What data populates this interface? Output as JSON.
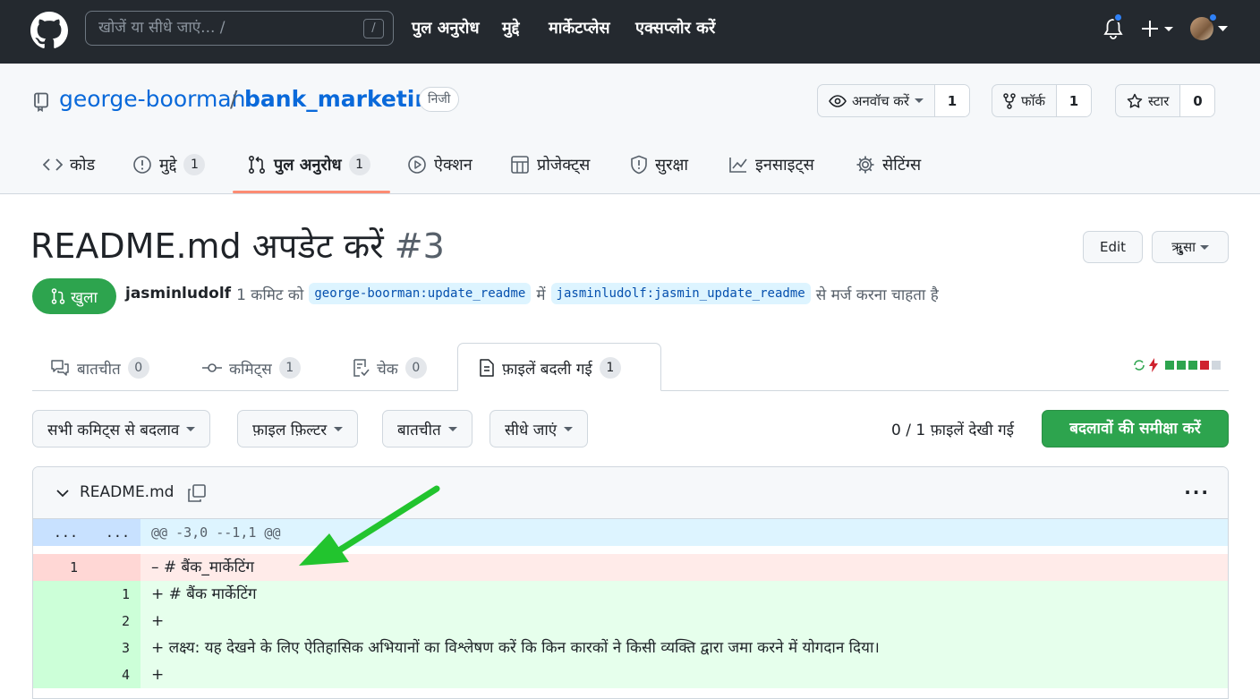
{
  "topnav": {
    "search_placeholder": "खोजें या सीधे जाएं... /",
    "search_key": "/",
    "links": [
      "पुल अनुरोध",
      "मुद्दे",
      "मार्केटप्लेस",
      "एक्सप्लोर करें"
    ],
    "icons": [
      "github-logo-icon",
      "bell-icon",
      "plus-icon",
      "avatar"
    ],
    "accent": "#2f81f7"
  },
  "repo": {
    "owner": "george-boorman",
    "separator": "/",
    "name": "bank_marketing",
    "visibility": "निजी",
    "watch": {
      "label": "अनवॉच करें",
      "count": "1"
    },
    "fork": {
      "label": "फॉर्क",
      "count": "1"
    },
    "star": {
      "label": "स्टार",
      "count": "0"
    },
    "tabs": [
      {
        "label": "कोड"
      },
      {
        "label": "मुद्दे",
        "count": "1"
      },
      {
        "label": "पुल अनुरोध",
        "count": "1"
      },
      {
        "label": "ऐक्शन"
      },
      {
        "label": "प्रोजेक्ट्स"
      },
      {
        "label": "सुरक्षा"
      },
      {
        "label": "इनसाइट्स"
      },
      {
        "label": "सेटिंग्स"
      }
    ]
  },
  "pr": {
    "title": "README.md अपडेट करें",
    "number": "#3",
    "edit_label": "Edit",
    "code_label": "ॠुसा",
    "state": "खुला",
    "author": "jasminludolf",
    "commits_text": "1 कमिट को",
    "base_branch": "george-boorman:update_readme",
    "in_text": "में",
    "head_branch": "jasminludolf:jasmin_update_readme",
    "suffix": "से मर्ज करना चाहता है",
    "state_color": "#2da44e"
  },
  "pr_tabs": [
    {
      "label": "बातचीत",
      "count": "0"
    },
    {
      "label": "कमिट्स",
      "count": "1"
    },
    {
      "label": "चेक",
      "count": "0"
    },
    {
      "label": "फ़ाइलें बदली गई",
      "count": "1"
    }
  ],
  "toolbar": {
    "commits_filter": "सभी कमिट्स से बदलाव",
    "file_filter": "फ़ाइल फ़िल्टर",
    "conversations": "बातचीत",
    "jump_to": "सीधे जाएं",
    "viewed": "0 / 1 फ़ाइलें देखी गई",
    "review_button": "बदलावों की समीक्षा करें"
  },
  "diff": {
    "filename": "README.md",
    "more": "···",
    "hunk": {
      "left": "...",
      "right": "...",
      "text": "@@ -3,0 --1,1 @@"
    },
    "lines": [
      {
        "type": "del",
        "old": "1",
        "new": "",
        "text": "– # बैंक_मार्केटिंग"
      },
      {
        "type": "add",
        "old": "",
        "new": "1",
        "text": "+ # बैंक मार्केटिंग"
      },
      {
        "type": "add",
        "old": "",
        "new": "2",
        "text": "+"
      },
      {
        "type": "add",
        "old": "",
        "new": "3",
        "text": "+ लक्ष्य: यह देखने के लिए ऐतिहासिक अभियानों का विश्लेषण करें कि किन कारकों ने किसी व्यक्ति द्वारा जमा करने में योगदान दिया।"
      },
      {
        "type": "add",
        "old": "",
        "new": "4",
        "text": "+"
      }
    ]
  }
}
